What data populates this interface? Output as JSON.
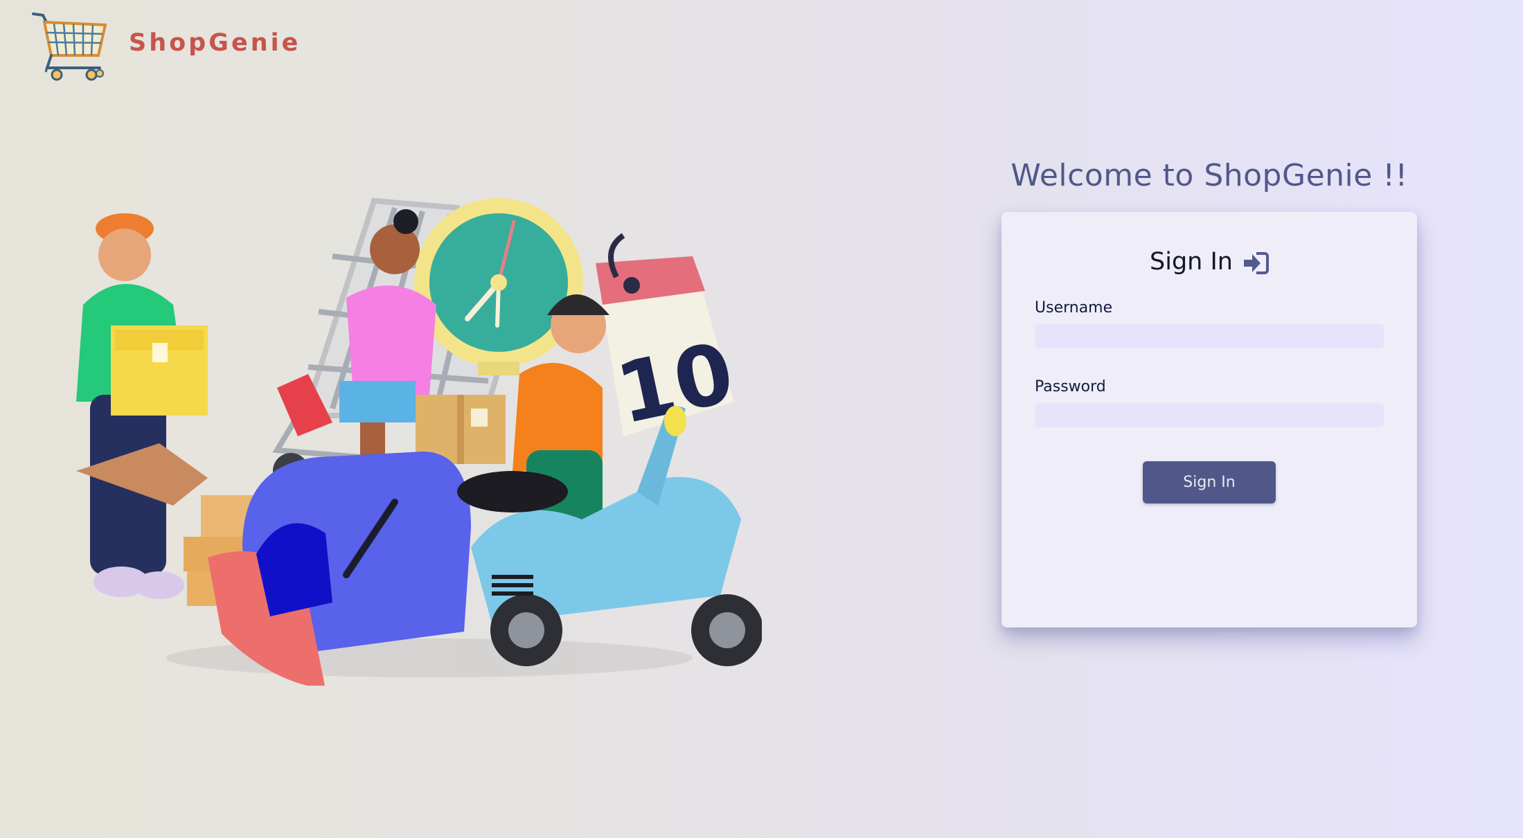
{
  "brand": {
    "name": "ShopGenie",
    "logo_icon": "shopping-cart-icon",
    "color": "#c7534d"
  },
  "hero": {
    "illustration": "delivery-shopping-illustration",
    "calendar_number": "10"
  },
  "welcome": {
    "heading": "Welcome to ShopGenie !!"
  },
  "login": {
    "title": "Sign In",
    "title_icon": "sign-in-icon",
    "username_label": "Username",
    "username_value": "",
    "password_label": "Password",
    "password_value": "",
    "submit_label": "Sign In"
  },
  "colors": {
    "accent": "#515889",
    "card_bg": "#eeedf8",
    "input_bg": "#e6e4fd",
    "heading": "#505889"
  }
}
